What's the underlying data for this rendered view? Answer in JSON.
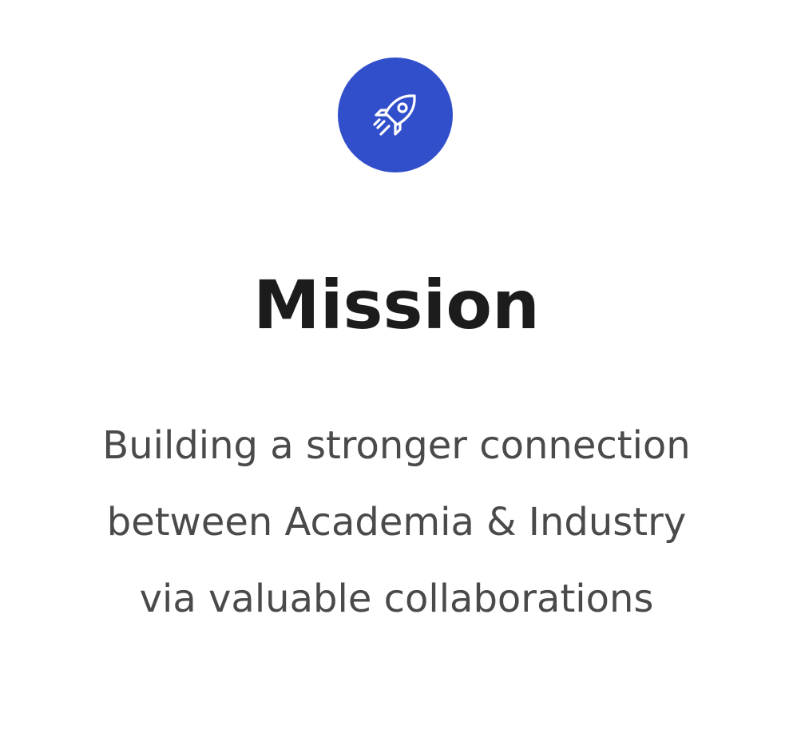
{
  "card": {
    "icon": "rocket-icon",
    "icon_background": "#314fcb",
    "title": "Mission",
    "description_lines": [
      "Building a stronger connection",
      "between Academia & Industry",
      "via valuable collaborations"
    ]
  }
}
